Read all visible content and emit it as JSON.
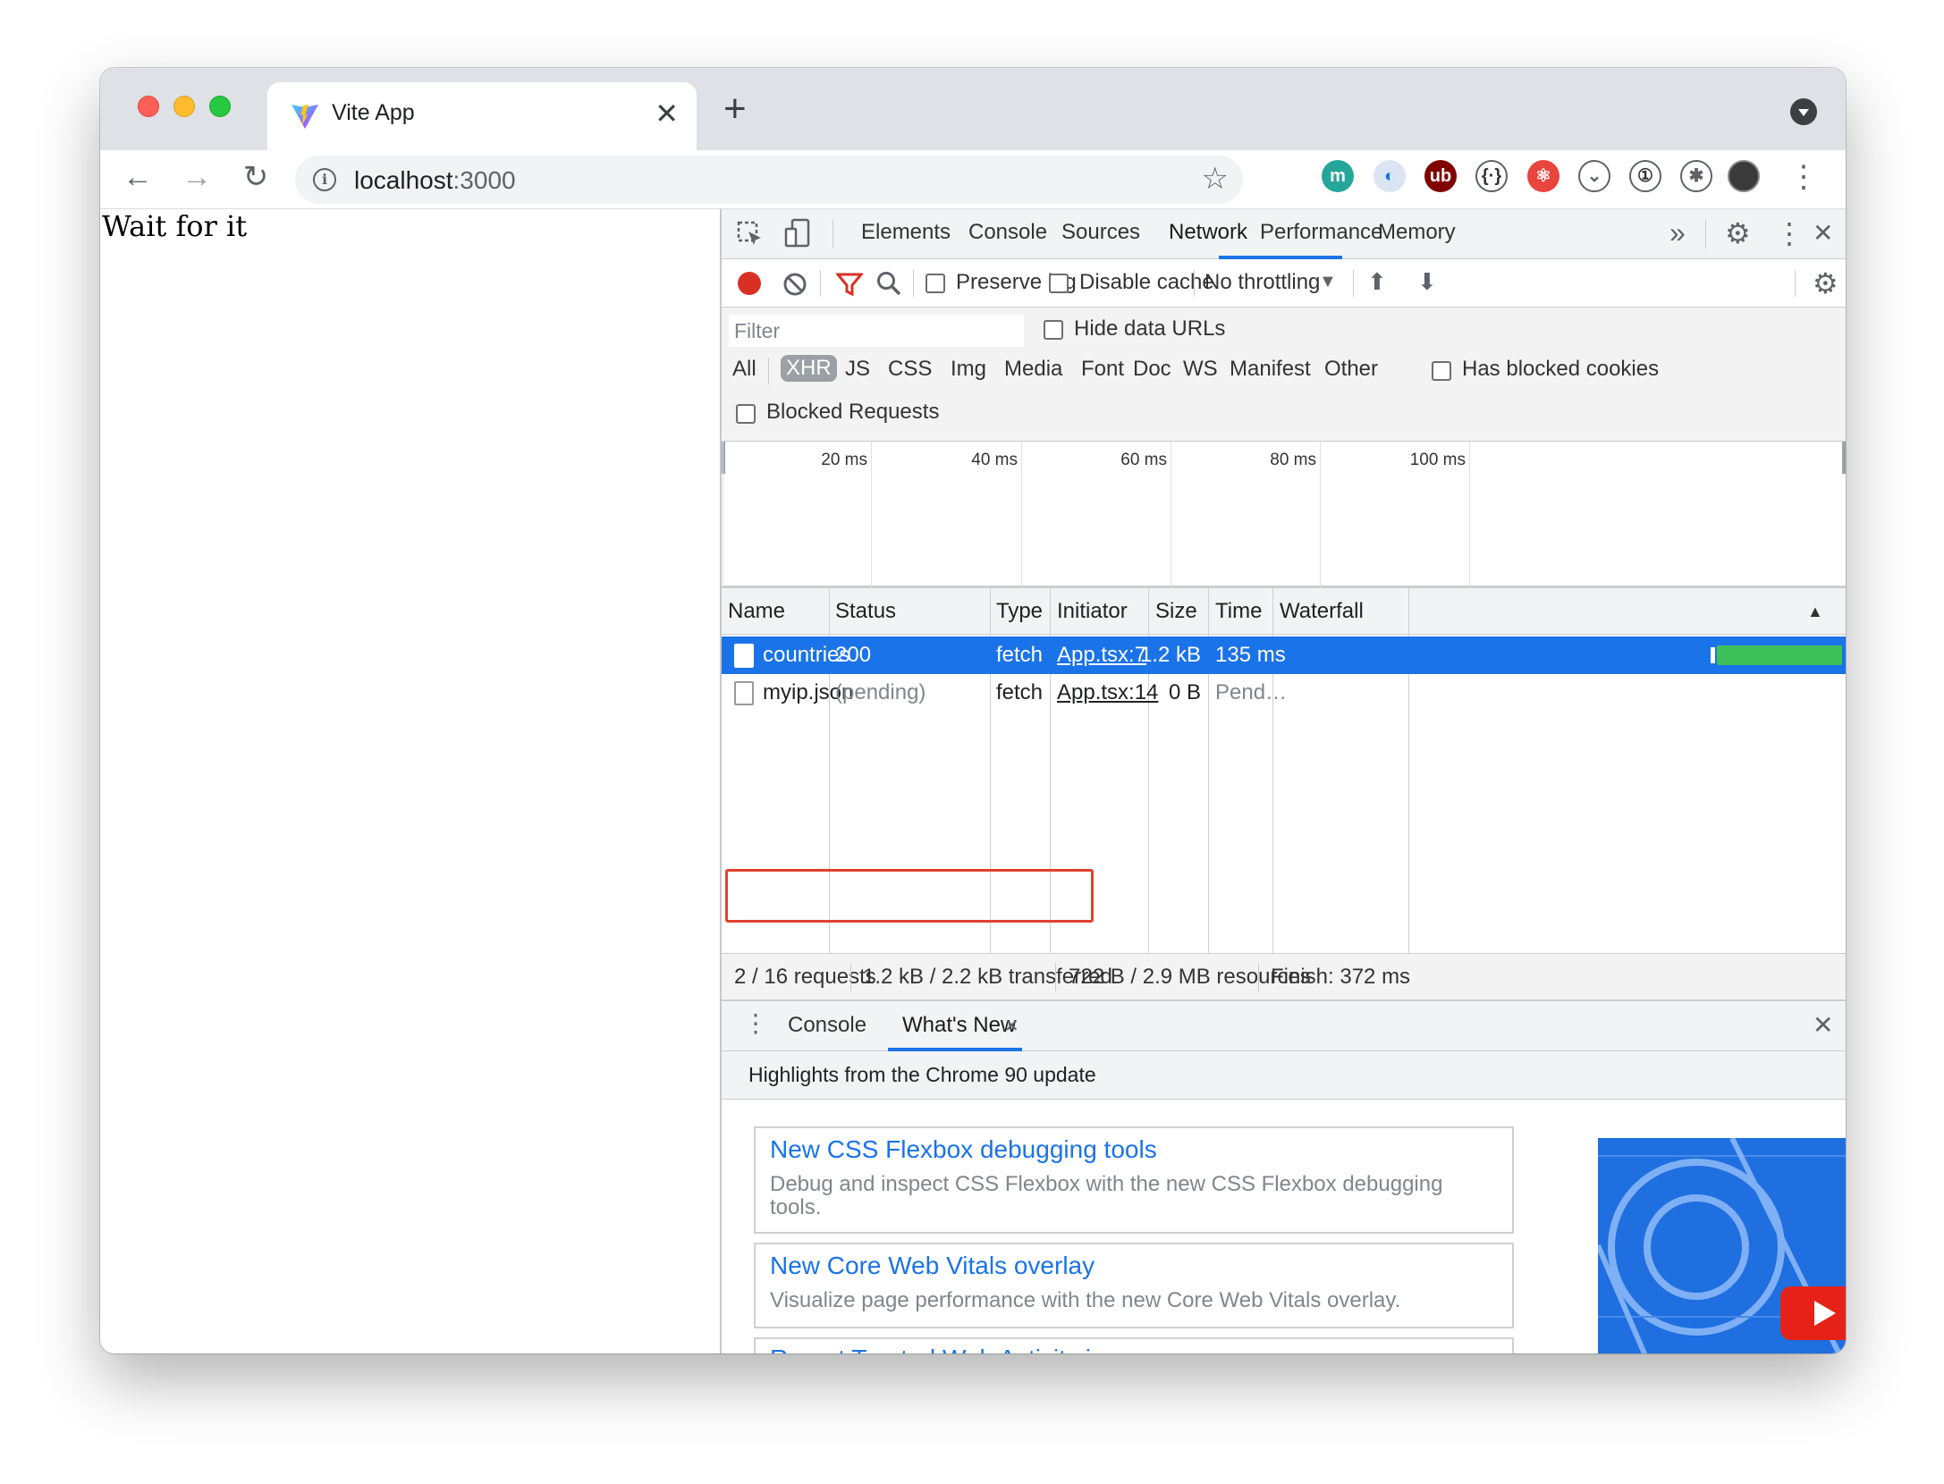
{
  "tab": {
    "title": "Vite App",
    "close": "✕",
    "new_tab": "+"
  },
  "toolbar": {
    "back": "←",
    "forward": "→",
    "reload": "↻",
    "url_host": "localhost",
    "url_port": ":3000",
    "info": "i",
    "star": "☆",
    "extensions": [
      {
        "name": "m-extension-icon",
        "glyph": "m",
        "bg": "#26a69a",
        "fg": "#ffffff"
      },
      {
        "name": "opera-vpn-icon",
        "glyph": "◐",
        "bg": "#dbe4f3",
        "fg": "#1a73e8"
      },
      {
        "name": "ublock-origin-icon",
        "glyph": "ub",
        "bg": "#800000",
        "fg": "#ffffff"
      },
      {
        "name": "json-viewer-icon",
        "glyph": "{·}",
        "bg": "#ffffff",
        "fg": "#333333"
      },
      {
        "name": "react-devtools-icon",
        "glyph": "⚛",
        "bg": "#e8453c",
        "fg": "#ffffff"
      },
      {
        "name": "pocket-icon",
        "glyph": "⌄",
        "bg": "#ffffff",
        "fg": "#5f6368"
      },
      {
        "name": "onepassword-icon",
        "glyph": "①",
        "bg": "#ffffff",
        "fg": "#333333"
      },
      {
        "name": "puzzle-extensions-icon",
        "glyph": "✱",
        "bg": "#ffffff",
        "fg": "#5f6368"
      }
    ],
    "menu": "⋮"
  },
  "page": {
    "text": "Wait for it"
  },
  "devtools": {
    "tabs": [
      "Elements",
      "Console",
      "Sources",
      "Network",
      "Performance",
      "Memory"
    ],
    "active_tab": "Network",
    "more": "»",
    "settings": "⚙",
    "menu": "⋮",
    "close": "✕",
    "toolbar": {
      "preserve_log": "Preserve log",
      "disable_cache": "Disable cache",
      "throttling": "No throttling",
      "throttling_arrow": "▼",
      "upload": "⬆",
      "download": "⬇"
    },
    "filter": {
      "placeholder": "Filter",
      "hide_data_urls": "Hide data URLs",
      "types": [
        "All",
        "XHR",
        "JS",
        "CSS",
        "Img",
        "Media",
        "Font",
        "Doc",
        "WS",
        "Manifest",
        "Other"
      ],
      "active_type": "XHR",
      "has_blocked_cookies": "Has blocked cookies",
      "blocked_requests": "Blocked Requests"
    },
    "overview": {
      "ticks": [
        "20 ms",
        "40 ms",
        "60 ms",
        "80 ms",
        "100 ms"
      ]
    },
    "columns": [
      "Name",
      "Status",
      "Type",
      "Initiator",
      "Size",
      "Time",
      "Waterfall"
    ],
    "sort_arrow": "▲",
    "rows": [
      {
        "name": "countries",
        "status": "200",
        "type": "fetch",
        "initiator": "App.tsx:7",
        "size": "1.2 kB",
        "time": "135 ms"
      },
      {
        "name": "myip.json",
        "status": "(pending)",
        "type": "fetch",
        "initiator": "App.tsx:14",
        "size": "0 B",
        "time": "Pend…"
      }
    ],
    "summary": {
      "requests": "2 / 16 requests",
      "transferred": "1.2 kB / 2.2 kB transferred",
      "resources": "722 B / 2.9 MB resources",
      "finish": "Finish: 372 ms"
    },
    "drawer": {
      "tabs": [
        "Console",
        "What's New"
      ],
      "active": "What's New",
      "tab_close": "✕",
      "close": "✕",
      "highlights": "Highlights from the Chrome 90 update",
      "cards": [
        {
          "title": "New CSS Flexbox debugging tools",
          "desc": "Debug and inspect CSS Flexbox with the new CSS Flexbox debugging tools."
        },
        {
          "title": "New Core Web Vitals overlay",
          "desc": "Visualize page performance with the new Core Web Vitals overlay."
        },
        {
          "title": "Report Trusted Web Activity issues",
          "desc": ""
        }
      ]
    }
  },
  "colors": {
    "accent": "#1a73e8",
    "record": "#d93025",
    "waterfall_bar": "#3ec15b",
    "highlight_box": "#e2412f"
  }
}
